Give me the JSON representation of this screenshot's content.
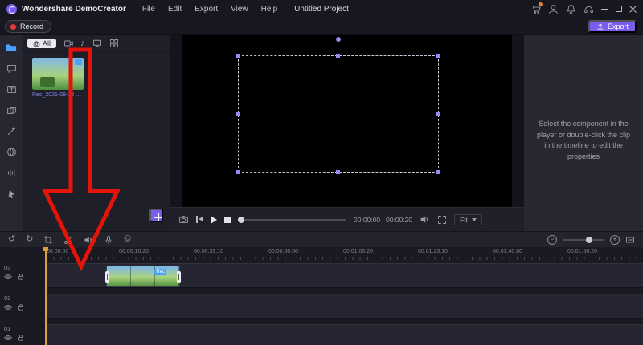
{
  "titlebar": {
    "app_name": "Wondershare DemoCreator",
    "menus": [
      "File",
      "Edit",
      "Export",
      "View",
      "Help"
    ],
    "project_title": "Untitled Project"
  },
  "toolbar": {
    "record_label": "Record",
    "export_label": "Export"
  },
  "media": {
    "all_tab_label": "All",
    "clip_name": "Rec_2021-09-13 05-28-2..."
  },
  "player": {
    "time_display": "00:00:00 | 00:00:20",
    "fit_label": "Fit"
  },
  "properties_hint": "Select the component in the player or double-click the clip in the timeline to edit the properties",
  "timeline": {
    "ruler_labels": [
      "00:00:00",
      "00:00:16:20",
      "00:00:33:10",
      "00:00:50:00",
      "00:01:06:20",
      "00:01:23:10",
      "00:01:40:00",
      "00:01:56:20"
    ],
    "tracks": [
      {
        "label": "03"
      },
      {
        "label": "02"
      },
      {
        "label": "01"
      }
    ],
    "clip_badge": "Rec"
  },
  "icons": {
    "undo": "↺",
    "redo": "↻",
    "music_note": "♪",
    "watermark": "©",
    "zoom_out": "−",
    "zoom_in": "+",
    "captions": "T"
  },
  "colors": {
    "accent": "#7b5cf0",
    "record_red": "#e23b3b",
    "arrow_red": "#e51408",
    "playhead": "#d9a03c",
    "selection_purple": "#9f86f2",
    "link_blue": "#8585f0"
  }
}
